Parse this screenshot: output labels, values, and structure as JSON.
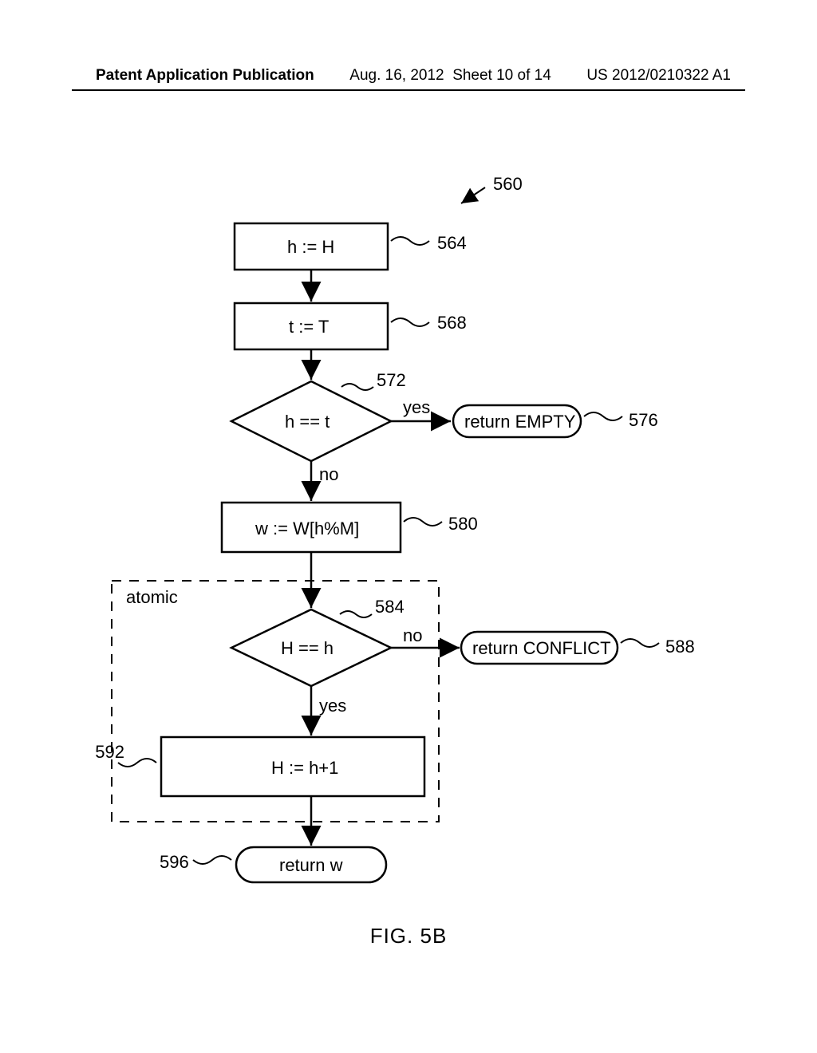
{
  "header": {
    "left": "Patent Application Publication",
    "date": "Aug. 16, 2012",
    "sheet": "Sheet 10 of 14",
    "pubno": "US 2012/0210322 A1"
  },
  "figure": {
    "caption": "FIG. 5B",
    "ref_main": "560",
    "nodes": {
      "n564": {
        "text": "h := H",
        "ref": "564"
      },
      "n568": {
        "text": "t := T",
        "ref": "568"
      },
      "n572": {
        "text": "h == t",
        "ref": "572"
      },
      "n576": {
        "text": "return EMPTY",
        "ref": "576"
      },
      "n580": {
        "text": "w := W[h%M]",
        "ref": "580"
      },
      "n584": {
        "text": "H == h",
        "ref": "584"
      },
      "n588": {
        "text": "return CONFLICT",
        "ref": "588"
      },
      "n592": {
        "text": "H := h+1",
        "ref": "592"
      },
      "n596": {
        "text": "return w",
        "ref": "596"
      }
    },
    "edges": {
      "yes": "yes",
      "no": "no"
    },
    "atomic_label": "atomic"
  }
}
